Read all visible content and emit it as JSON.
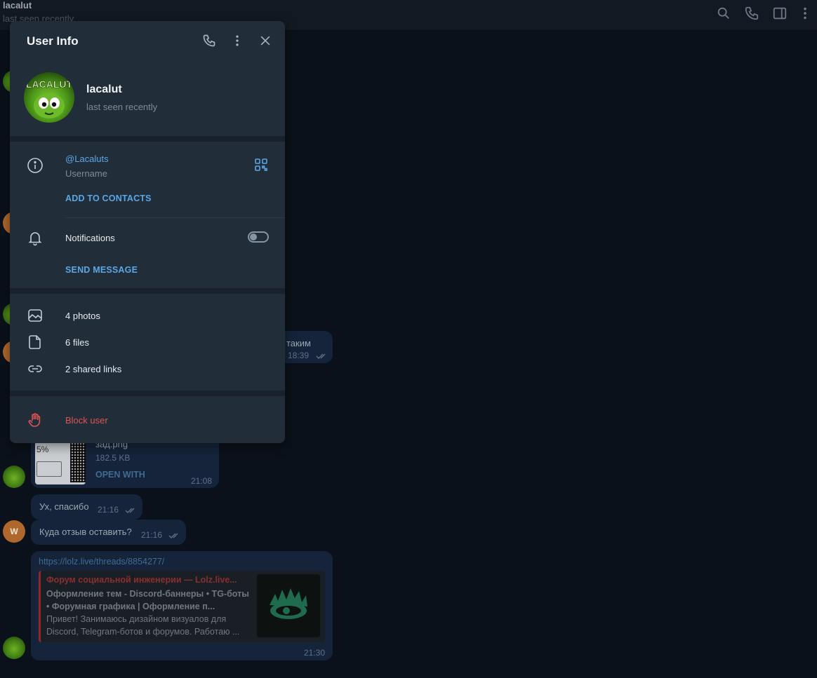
{
  "chat": {
    "title": "lacalut",
    "status": "last seen recently",
    "messages": [
      {
        "text": "таким",
        "time": "18:39"
      },
      {
        "file_name": "зад.png",
        "file_size": "182.5 KB",
        "file_action": "OPEN WITH",
        "time": "21:08",
        "thumb_text": "5%"
      },
      {
        "text": "Ух, спасибо",
        "time": "21:16"
      },
      {
        "text": "Куда отзыв оставить?",
        "time": "21:16",
        "avatar_letter": "W"
      },
      {
        "link": "https://lolz.live/threads/8854277/",
        "preview_site": "Форум социальной инженерии — Lolz.live...",
        "preview_title": "Оформление тем - Discord-баннеры • TG-боты • Форумная графика | Оформление п...",
        "preview_desc": "Привет! Занимаюсь дизайном визуалов для Discord, Telegram-ботов и форумов. Работаю ...",
        "time": "21:30"
      }
    ]
  },
  "panel": {
    "title": "User Info",
    "profile": {
      "name": "lacalut",
      "status": "last seen recently",
      "avatar_text": "LACALUT"
    },
    "username": {
      "value": "@Lacaluts",
      "label": "Username"
    },
    "add_contact": "ADD TO CONTACTS",
    "notifications": {
      "label": "Notifications",
      "enabled": false
    },
    "send_message": "SEND MESSAGE",
    "media": [
      {
        "icon": "photo-icon",
        "label": "4 photos"
      },
      {
        "icon": "file-icon",
        "label": "6 files"
      },
      {
        "icon": "link-icon",
        "label": "2 shared links"
      }
    ],
    "block": "Block user"
  },
  "colors": {
    "accent": "#5aa7e6",
    "danger": "#e05252",
    "panel_bg": "#222d3a",
    "chat_bg": "#0b111a"
  }
}
